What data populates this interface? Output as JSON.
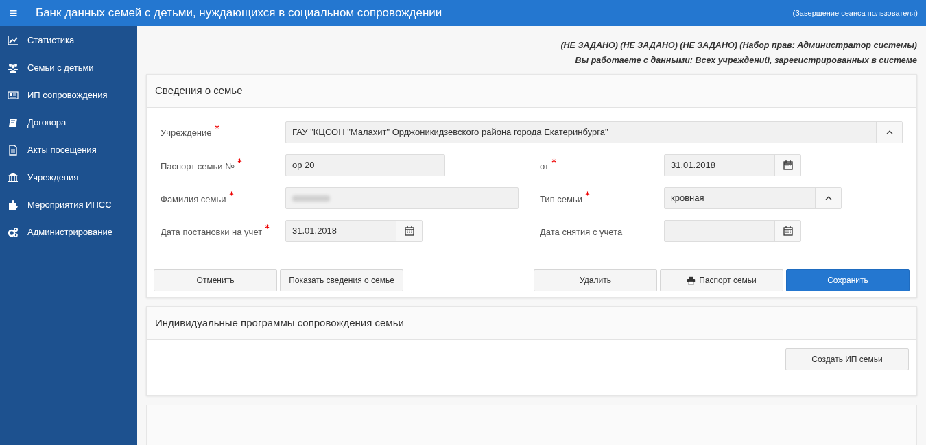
{
  "header": {
    "menu_glyph": "≡",
    "title": "Банк данных семей с детьми, нуждающихся в социальном сопровождении",
    "logout": "(Завершение сеанса пользователя)"
  },
  "sidebar": {
    "items": [
      {
        "label": "Статистика",
        "selected": false
      },
      {
        "label": "Семьи с детьми",
        "selected": false
      },
      {
        "label": "ИП сопровождения",
        "selected": false
      },
      {
        "label": "Договора",
        "selected": false
      },
      {
        "label": "Акты посещения",
        "selected": false
      },
      {
        "label": "Учреждения",
        "selected": false
      },
      {
        "label": "Мероприятия ИПСС",
        "selected": false
      },
      {
        "label": "Администрирование",
        "selected": false
      }
    ]
  },
  "user_info": [
    "(НЕ ЗАДАНО) (НЕ ЗАДАНО) (НЕ ЗАДАНО) (Набор прав: Администратор системы)",
    "Вы работаете с данными: Всех учреждений, зарегистрированных в системе"
  ],
  "family_card": {
    "title": "Сведения о семье",
    "fields": [
      {
        "label": "Учреждение",
        "required": true,
        "kind": "select",
        "value": "ГАУ \"КЦСОН \"Малахит\" Орджоникидзевского района города Екатеринбурга\""
      },
      {
        "label": "Паспорт семьи №",
        "required": true,
        "kind": "text",
        "value": "ор 20"
      },
      {
        "label": "от",
        "required": true,
        "kind": "date",
        "value": "31.01.2018"
      },
      {
        "label": "Фамилия семьи",
        "required": true,
        "kind": "redacted"
      },
      {
        "label": "Тип семьи",
        "required": true,
        "kind": "select",
        "value": "кровная"
      },
      {
        "label": "Дата постановки на учет",
        "required": true,
        "kind": "date",
        "value": "31.01.2018"
      },
      {
        "label": "Дата снятия с учета",
        "required": false,
        "kind": "date"
      }
    ],
    "buttons_left": [
      {
        "label": "Отменить"
      },
      {
        "label": "Показать сведения о семье"
      }
    ],
    "buttons_right": [
      {
        "label": "Удалить",
        "kind": "default"
      },
      {
        "label": "Паспорт семьи",
        "kind": "print"
      },
      {
        "label": "Сохранить",
        "kind": "primary"
      }
    ]
  },
  "ip_card": {
    "title": "Индивидуальные программы сопровождения семьи",
    "button": "Создать ИП семьи"
  }
}
